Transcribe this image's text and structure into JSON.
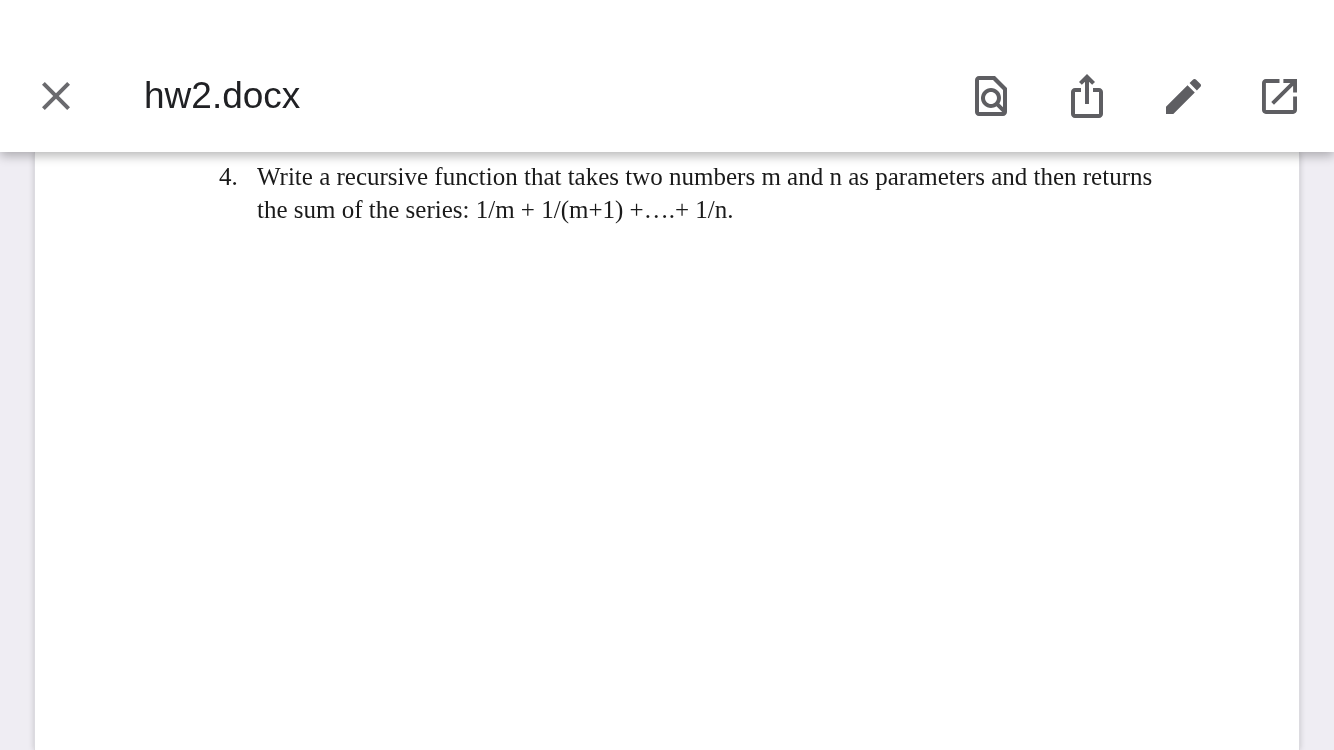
{
  "app_bar": {
    "title": "hw2.docx"
  },
  "document": {
    "list_items": [
      {
        "number": "4.",
        "text": "Write a recursive function that takes two numbers m and n as parameters and then returns the sum of the series: 1/m + 1/(m+1) +….+ 1/n."
      }
    ]
  }
}
